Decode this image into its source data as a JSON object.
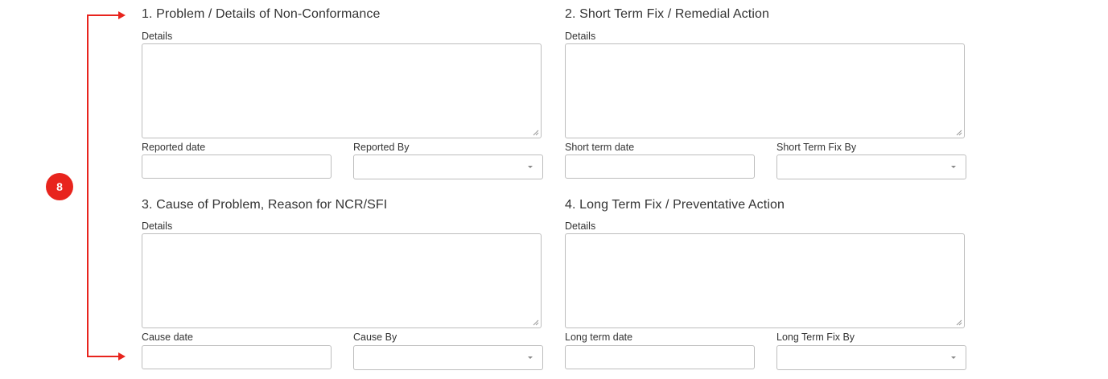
{
  "annotation": {
    "badge": "8",
    "color": "#e8241d"
  },
  "sections": [
    {
      "title": "1. Problem / Details of Non-Conformance",
      "details_label": "Details",
      "details_value": "",
      "date_label": "Reported date",
      "date_value": "",
      "by_label": "Reported By",
      "by_value": ""
    },
    {
      "title": "2. Short Term Fix / Remedial Action",
      "details_label": "Details",
      "details_value": "",
      "date_label": "Short term date",
      "date_value": "",
      "by_label": "Short Term Fix By",
      "by_value": ""
    },
    {
      "title": "3. Cause of Problem, Reason for NCR/SFI",
      "details_label": "Details",
      "details_value": "",
      "date_label": "Cause date",
      "date_value": "",
      "by_label": "Cause By",
      "by_value": ""
    },
    {
      "title": "4. Long Term Fix / Preventative Action",
      "details_label": "Details",
      "details_value": "",
      "date_label": "Long term date",
      "date_value": "",
      "by_label": "Long Term Fix By",
      "by_value": ""
    }
  ],
  "icons": {
    "select_caret": "chevron-down-icon",
    "resize": "resize-grip-icon"
  }
}
